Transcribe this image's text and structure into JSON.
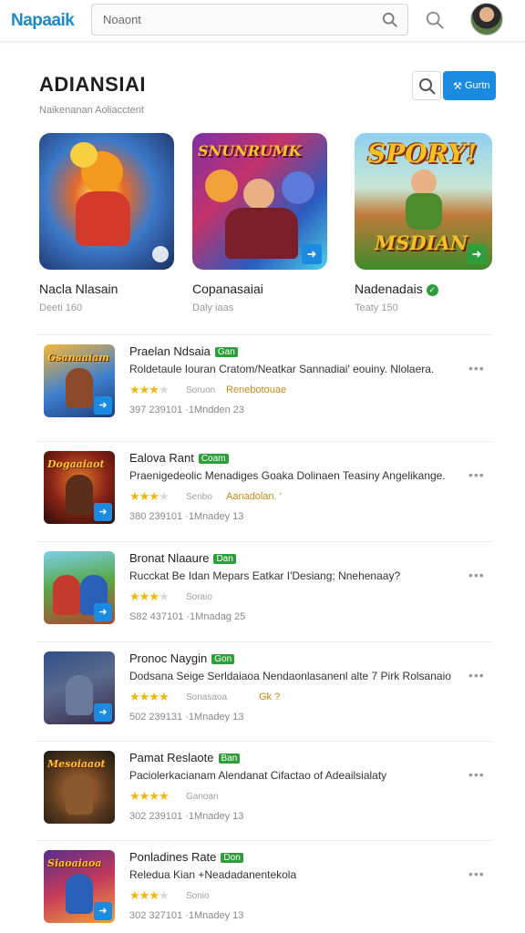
{
  "header": {
    "logo": "Napaaik",
    "search_placeholder": "Noaont"
  },
  "section": {
    "title": "ADIANSIAI",
    "subtitle": "Naikenanan Aoliacctent",
    "button_label": "Gurtn"
  },
  "featured": [
    {
      "title": "Nacla Nlasain",
      "meta": "Deeti 160"
    },
    {
      "title": "Copanasaiai",
      "meta": "Daly iaas",
      "art_text": "SNUNRUMK"
    },
    {
      "title": "Nadenadais",
      "meta": "Teaty 150",
      "art_top": "SPORY!",
      "art_bottom": "MSDIAN"
    }
  ],
  "list": [
    {
      "name": "Praelan Ndsaia",
      "tag": "Gan",
      "desc": "Roldetaule Iouran Cratom/Neatkar Sannadiai' eouiny. Nlolaera.",
      "rating": 3,
      "category": "Soruon",
      "label": "Renebotouae",
      "stats": "397 239101 ·1Mndden  23",
      "thumb_text": "Gsanaaiam"
    },
    {
      "name": "Ealova Rant",
      "tag": "Coam",
      "desc": "Praenigedeolic Menadiges Goaka Dolinaen Teasiny Angelikange.",
      "rating": 3,
      "category": "Senbo",
      "label": "Aanadolan. '",
      "stats": "380 239101 ·1Mnadey  13",
      "thumb_text": "Dogaaiaot"
    },
    {
      "name": "Bronat Nlaaure",
      "tag": "Dan",
      "desc": "Rucckat Be Idan Mepars Eatkar I'Desiang; Nnehenaay?",
      "rating": 3,
      "category": "Soraio",
      "label": "",
      "stats": "S82 437101 ·1Mnadag  25",
      "thumb_text": ""
    },
    {
      "name": "Pronoc Naygin",
      "tag": "Gon",
      "desc": "Dodsana Seige Serldaiaoa Nendaonlasanenl alte 7 Pirk Rolsanaio",
      "rating": 4,
      "category": "Sonasaoa",
      "label": "Gk ?",
      "stats": "502 239131 ·1Mnadey  13",
      "thumb_text": ""
    },
    {
      "name": "Pamat Reslaote",
      "tag": "Ban",
      "desc": "Paciolerkacianam Alendanat Cifactao of Adeailsialaty",
      "rating": 4,
      "category": "Ganoan",
      "label": "",
      "stats": "302 239101 ·1Mnadey  13",
      "thumb_text": "Mesoiaaot"
    },
    {
      "name": "Ponladines Rate",
      "tag": "Don",
      "desc": "Reledua Kian +Neadadanentekola",
      "rating": 3,
      "category": "Sonio",
      "label": "",
      "stats": "302 327101 ·1Mnadey  13",
      "thumb_text": "Siaoaiaoa"
    }
  ]
}
